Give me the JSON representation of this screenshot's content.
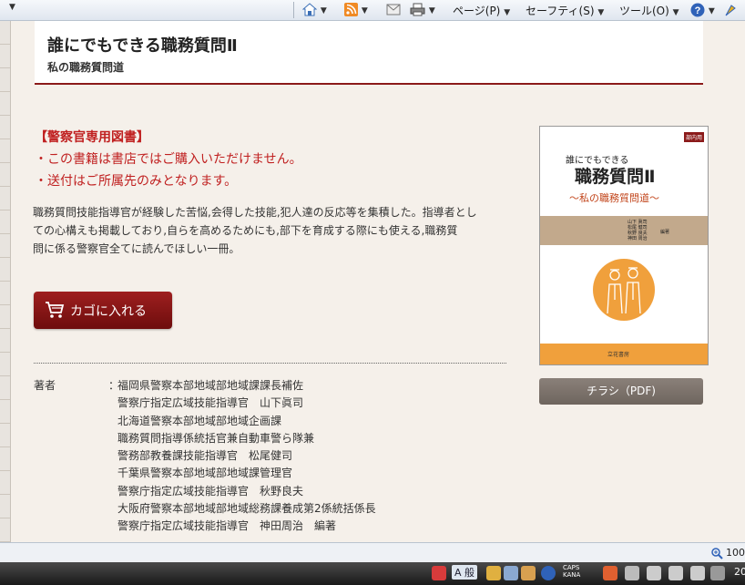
{
  "toolbar": {
    "page_menu": "ページ(P)",
    "safety_menu": "セーフティ(S)",
    "tools_menu": "ツール(O)",
    "help_icon": "help-icon"
  },
  "page": {
    "title": "誰にでもできる職務質問Ⅱ",
    "subtitle": "私の職務質問道",
    "notice_head": "【警察官専用図書】",
    "notice_lines": [
      "・この書籍は書店ではご購入いただけません。",
      "・送付はご所属先のみとなります。"
    ],
    "description_lines": [
      "職務質問技能指導官が経験した苦悩,会得した技能,犯人達の反応等を集積した。指導者とし",
      "ての心構えも掲載しており,自らを高めるためにも,部下を育成する際にも使える,職務質",
      "問に係る警察官全てに読んでほしい一冊。"
    ],
    "cart_button": "カゴに入れる",
    "author_label": "著者",
    "author_colon": "：",
    "authors": [
      "福岡県警察本部地域部地域課課長補佐",
      "警察庁指定広域技能指導官　山下眞司",
      "北海道警察本部地域部地域企画課",
      "職務質問指導係統括官兼自動車警ら隊兼",
      "警務部教養課技能指導官　松尾健司",
      "千葉県警察本部地域部地域課管理官",
      "警察庁指定広域技能指導官　秋野良夫",
      "大阪府警察本部地域部地域総務課養成第2係統括係長",
      "警察庁指定広域技能指導官　神田周治　編著"
    ],
    "pdf_button": "チラシ（PDF)"
  },
  "book_cover": {
    "badge": "部内用",
    "small_title": "誰にでもできる",
    "main_title": "職務質問Ⅱ",
    "sub_title": "〜私の職務質問道〜",
    "names": [
      "山下 眞司",
      "松尾 健司",
      "秋野 良夫",
      "神田 周治"
    ],
    "names_suffix": "編著",
    "publisher": "立花書房"
  },
  "statusbar": {
    "zoom": "100"
  },
  "taskbar": {
    "caps": "CAPS",
    "kana": "KANA",
    "ime": "A 般",
    "clock": "20"
  },
  "colors": {
    "accent": "#8b1a1a",
    "notice": "#c02020",
    "book_orange": "#f0a03c"
  }
}
